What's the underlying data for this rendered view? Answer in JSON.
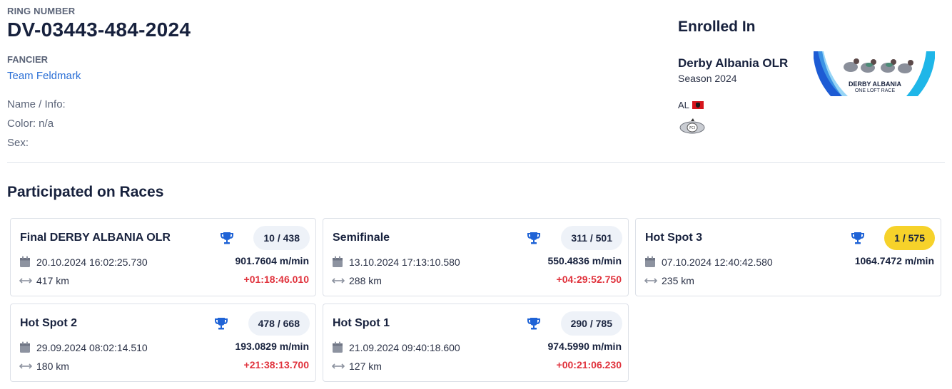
{
  "bird": {
    "ring_label": "RING NUMBER",
    "ring_number": "DV-03443-484-2024",
    "fancier_label": "FANCIER",
    "fancier_name": "Team Feldmark",
    "name_info": "Name / Info:",
    "color": "Color: n/a",
    "sex": "Sex:"
  },
  "enrolled": {
    "title": "Enrolled In",
    "race_name": "Derby Albania OLR",
    "season": "Season 2024",
    "country_code": "AL",
    "logo_text_1": "DERBY ALBANIA",
    "logo_text_2": "ONE LOFT RACE"
  },
  "races_section": {
    "title": "Participated on Races",
    "races": [
      {
        "name": "Final DERBY ALBANIA OLR",
        "rank": "10 / 438",
        "date": "20.10.2024 16:02:25.730",
        "speed": "901.7604 m/min",
        "distance": "417 km",
        "diff": "+01:18:46.010",
        "highlight": false
      },
      {
        "name": "Semifinale",
        "rank": "311 / 501",
        "date": "13.10.2024 17:13:10.580",
        "speed": "550.4836 m/min",
        "distance": "288 km",
        "diff": "+04:29:52.750",
        "highlight": false
      },
      {
        "name": "Hot Spot 3",
        "rank": "1 / 575",
        "date": "07.10.2024 12:40:42.580",
        "speed": "1064.7472 m/min",
        "distance": "235 km",
        "diff": "",
        "highlight": true
      },
      {
        "name": "Hot Spot 2",
        "rank": "478 / 668",
        "date": "29.09.2024 08:02:14.510",
        "speed": "193.0829 m/min",
        "distance": "180 km",
        "diff": "+21:38:13.700",
        "highlight": false
      },
      {
        "name": "Hot Spot 1",
        "rank": "290 / 785",
        "date": "21.09.2024 09:40:18.600",
        "speed": "974.5990 m/min",
        "distance": "127 km",
        "diff": "+00:21:06.230",
        "highlight": false
      }
    ]
  },
  "colors": {
    "accent_blue": "#2a6fd6",
    "trophy_blue": "#1f63d6",
    "gold": "#f6d22a",
    "negative_red": "#e0323c"
  },
  "icons": {
    "trophy": "trophy-icon",
    "calendar": "calendar-icon",
    "distance": "distance-arrow-icon",
    "flag": "albania-flag-icon"
  }
}
